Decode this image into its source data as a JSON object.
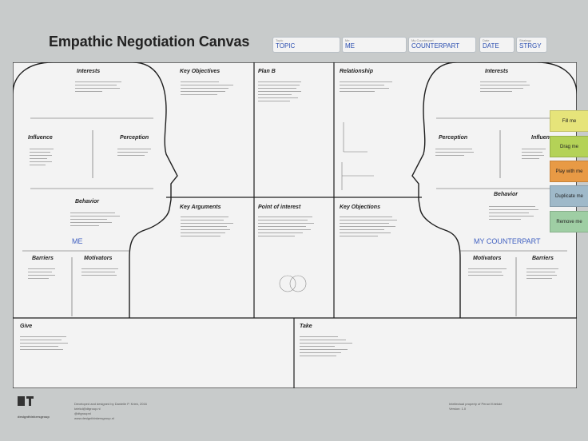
{
  "title": "Empathic Negotiation Canvas",
  "fields": [
    {
      "label": "Topic",
      "value": "TOPIC"
    },
    {
      "label": "Me",
      "value": "ME"
    },
    {
      "label": "My Counterpart",
      "value": "COUNTERPART"
    },
    {
      "label": "Date",
      "value": "DATE"
    },
    {
      "label": "Strategy",
      "value": "STRGY"
    }
  ],
  "sections": {
    "interests_left": "Interests",
    "influence": "Influence",
    "perception_left": "Perception",
    "behavior_left": "Behavior",
    "barriers_left": "Barriers",
    "motivators_left": "Motivators",
    "key_objectives": "Key Objectives",
    "plan_b": "Plan B",
    "relationship": "Relationship",
    "key_arguments": "Key Arguments",
    "point_of_interest": "Point of interest",
    "key_objections": "Key Objections",
    "interests_right": "Interests",
    "perception_right": "Perception",
    "influence_right": "Influen",
    "behavior_right": "Behavior",
    "motivators_right": "Motivators",
    "barriers_right": "Barriers",
    "give": "Give",
    "take": "Take"
  },
  "labels": {
    "me": "ME",
    "counterpart": "MY COUNTERPART"
  },
  "buttons": [
    {
      "label": "Fill me",
      "color": "#e6e47a"
    },
    {
      "label": "Drag me",
      "color": "#b4d257"
    },
    {
      "label": "Play with me",
      "color": "#e89a45"
    },
    {
      "label": "Duplicate me",
      "color": "#9fb9c9"
    },
    {
      "label": "Remove me",
      "color": "#9fcea4"
    }
  ],
  "footer": {
    "brand": "designthinkersgroup",
    "credit_lines": [
      "Developed and designed by Danielle P. Kriek, 2016",
      "kriekd@dtgroup.nl",
      "@dtgroupnl",
      "www.designthinkersgroup.nl"
    ],
    "right_lines": [
      "Intellectual property of Peruvi Kriekde",
      "Version: 1.0"
    ]
  },
  "colors": {
    "background": "#c8cbcb",
    "board": "#f3f3f3",
    "line": "#1e1e1e",
    "accent": "#3f5fc0"
  }
}
